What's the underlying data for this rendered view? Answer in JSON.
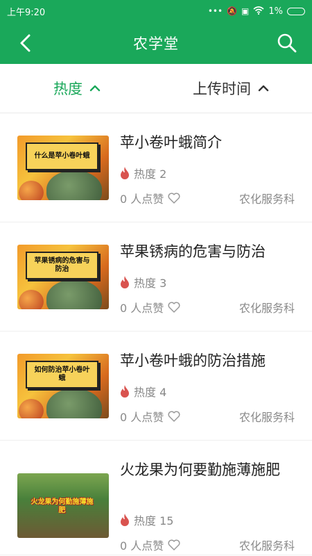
{
  "status_bar": {
    "time": "上午9:20",
    "battery": "1%"
  },
  "header": {
    "title": "农学堂"
  },
  "sort": {
    "hot_label": "热度",
    "time_label": "上传时间"
  },
  "articles": [
    {
      "title": "苹小卷叶蛾简介",
      "hot_text": "热度 2",
      "likes_text": "0 人点赞",
      "source": "农化服务科",
      "thumb_text": "什么是苹小卷叶蛾"
    },
    {
      "title": "苹果锈病的危害与防治",
      "hot_text": "热度 3",
      "likes_text": "0 人点赞",
      "source": "农化服务科",
      "thumb_text": "苹果锈病的危害与防治"
    },
    {
      "title": "苹小卷叶蛾的防治措施",
      "hot_text": "热度 4",
      "likes_text": "0 人点赞",
      "source": "农化服务科",
      "thumb_text": "如何防治苹小卷叶蛾"
    },
    {
      "title": "火龙果为何要勤施薄施肥",
      "hot_text": "热度 15",
      "likes_text": "0 人点赞",
      "source": "农化服务科",
      "thumb_text": "火龙果为何勤施薄施肥"
    }
  ],
  "colors": {
    "primary": "#1aa85a",
    "hot_icon": "#d9534f"
  }
}
